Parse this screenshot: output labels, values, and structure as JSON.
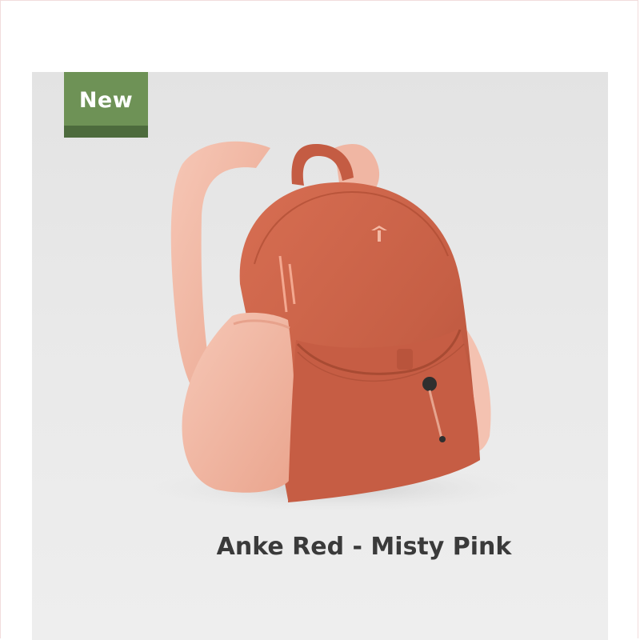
{
  "badge": {
    "label": "New",
    "color": "#6e9256"
  },
  "product": {
    "name": "Anke Red - Misty Pink",
    "colors": {
      "body": "#c9614a",
      "accent": "#f2b8a6",
      "background": "#e8e8e8"
    }
  }
}
